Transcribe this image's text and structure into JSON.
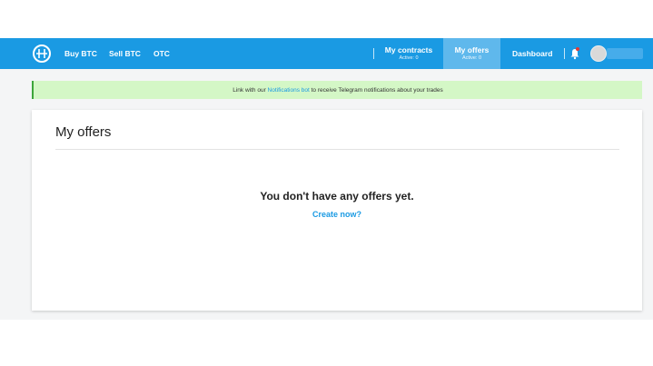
{
  "nav": {
    "brand_icon": "hodl-logo-icon",
    "links": [
      "Buy BTC",
      "Sell BTC",
      "OTC"
    ],
    "my_contracts": {
      "label": "My contracts",
      "sub": "Active: 0"
    },
    "my_offers": {
      "label": "My offers",
      "sub": "Active: 0"
    },
    "dashboard": "Dashboard",
    "bell_icon": "bell-icon"
  },
  "alert": {
    "before": "Link with our ",
    "link": "Notifications bot",
    "after": " to receive Telegram notifications about your trades"
  },
  "card": {
    "title": "My offers",
    "empty_message": "You don't have any offers yet.",
    "create_link": "Create now?"
  },
  "colors": {
    "brand": "#1a9ae3",
    "active_tab": "#5fb8ec",
    "alert_bg": "#d4f7c6",
    "alert_border": "#3ea53b"
  }
}
